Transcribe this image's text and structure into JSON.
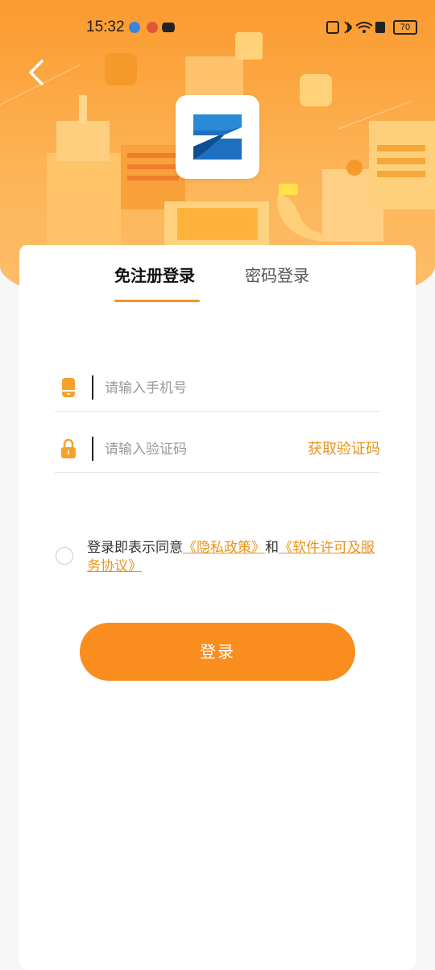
{
  "status_bar": {
    "time": "15:32",
    "battery": "70"
  },
  "header": {
    "back_icon": "chevron-left-icon",
    "logo_icon": "z-app-logo"
  },
  "tabs": [
    {
      "label": "免注册登录",
      "active": true
    },
    {
      "label": "密码登录",
      "active": false
    }
  ],
  "form": {
    "phone": {
      "placeholder": "请输入手机号",
      "value": "",
      "icon": "phone-icon"
    },
    "code": {
      "placeholder": "请输入验证码",
      "value": "",
      "icon": "lock-icon",
      "action": "获取验证码"
    }
  },
  "agreement": {
    "prefix": "登录即表示同意",
    "privacy_link": "《隐私政策》",
    "and": "和",
    "license_link": "《软件许可及服务协议》"
  },
  "login_button": "登录",
  "colors": {
    "accent": "#f98e1f",
    "link": "#e8941c",
    "hero_top": "#fb9a2e"
  }
}
